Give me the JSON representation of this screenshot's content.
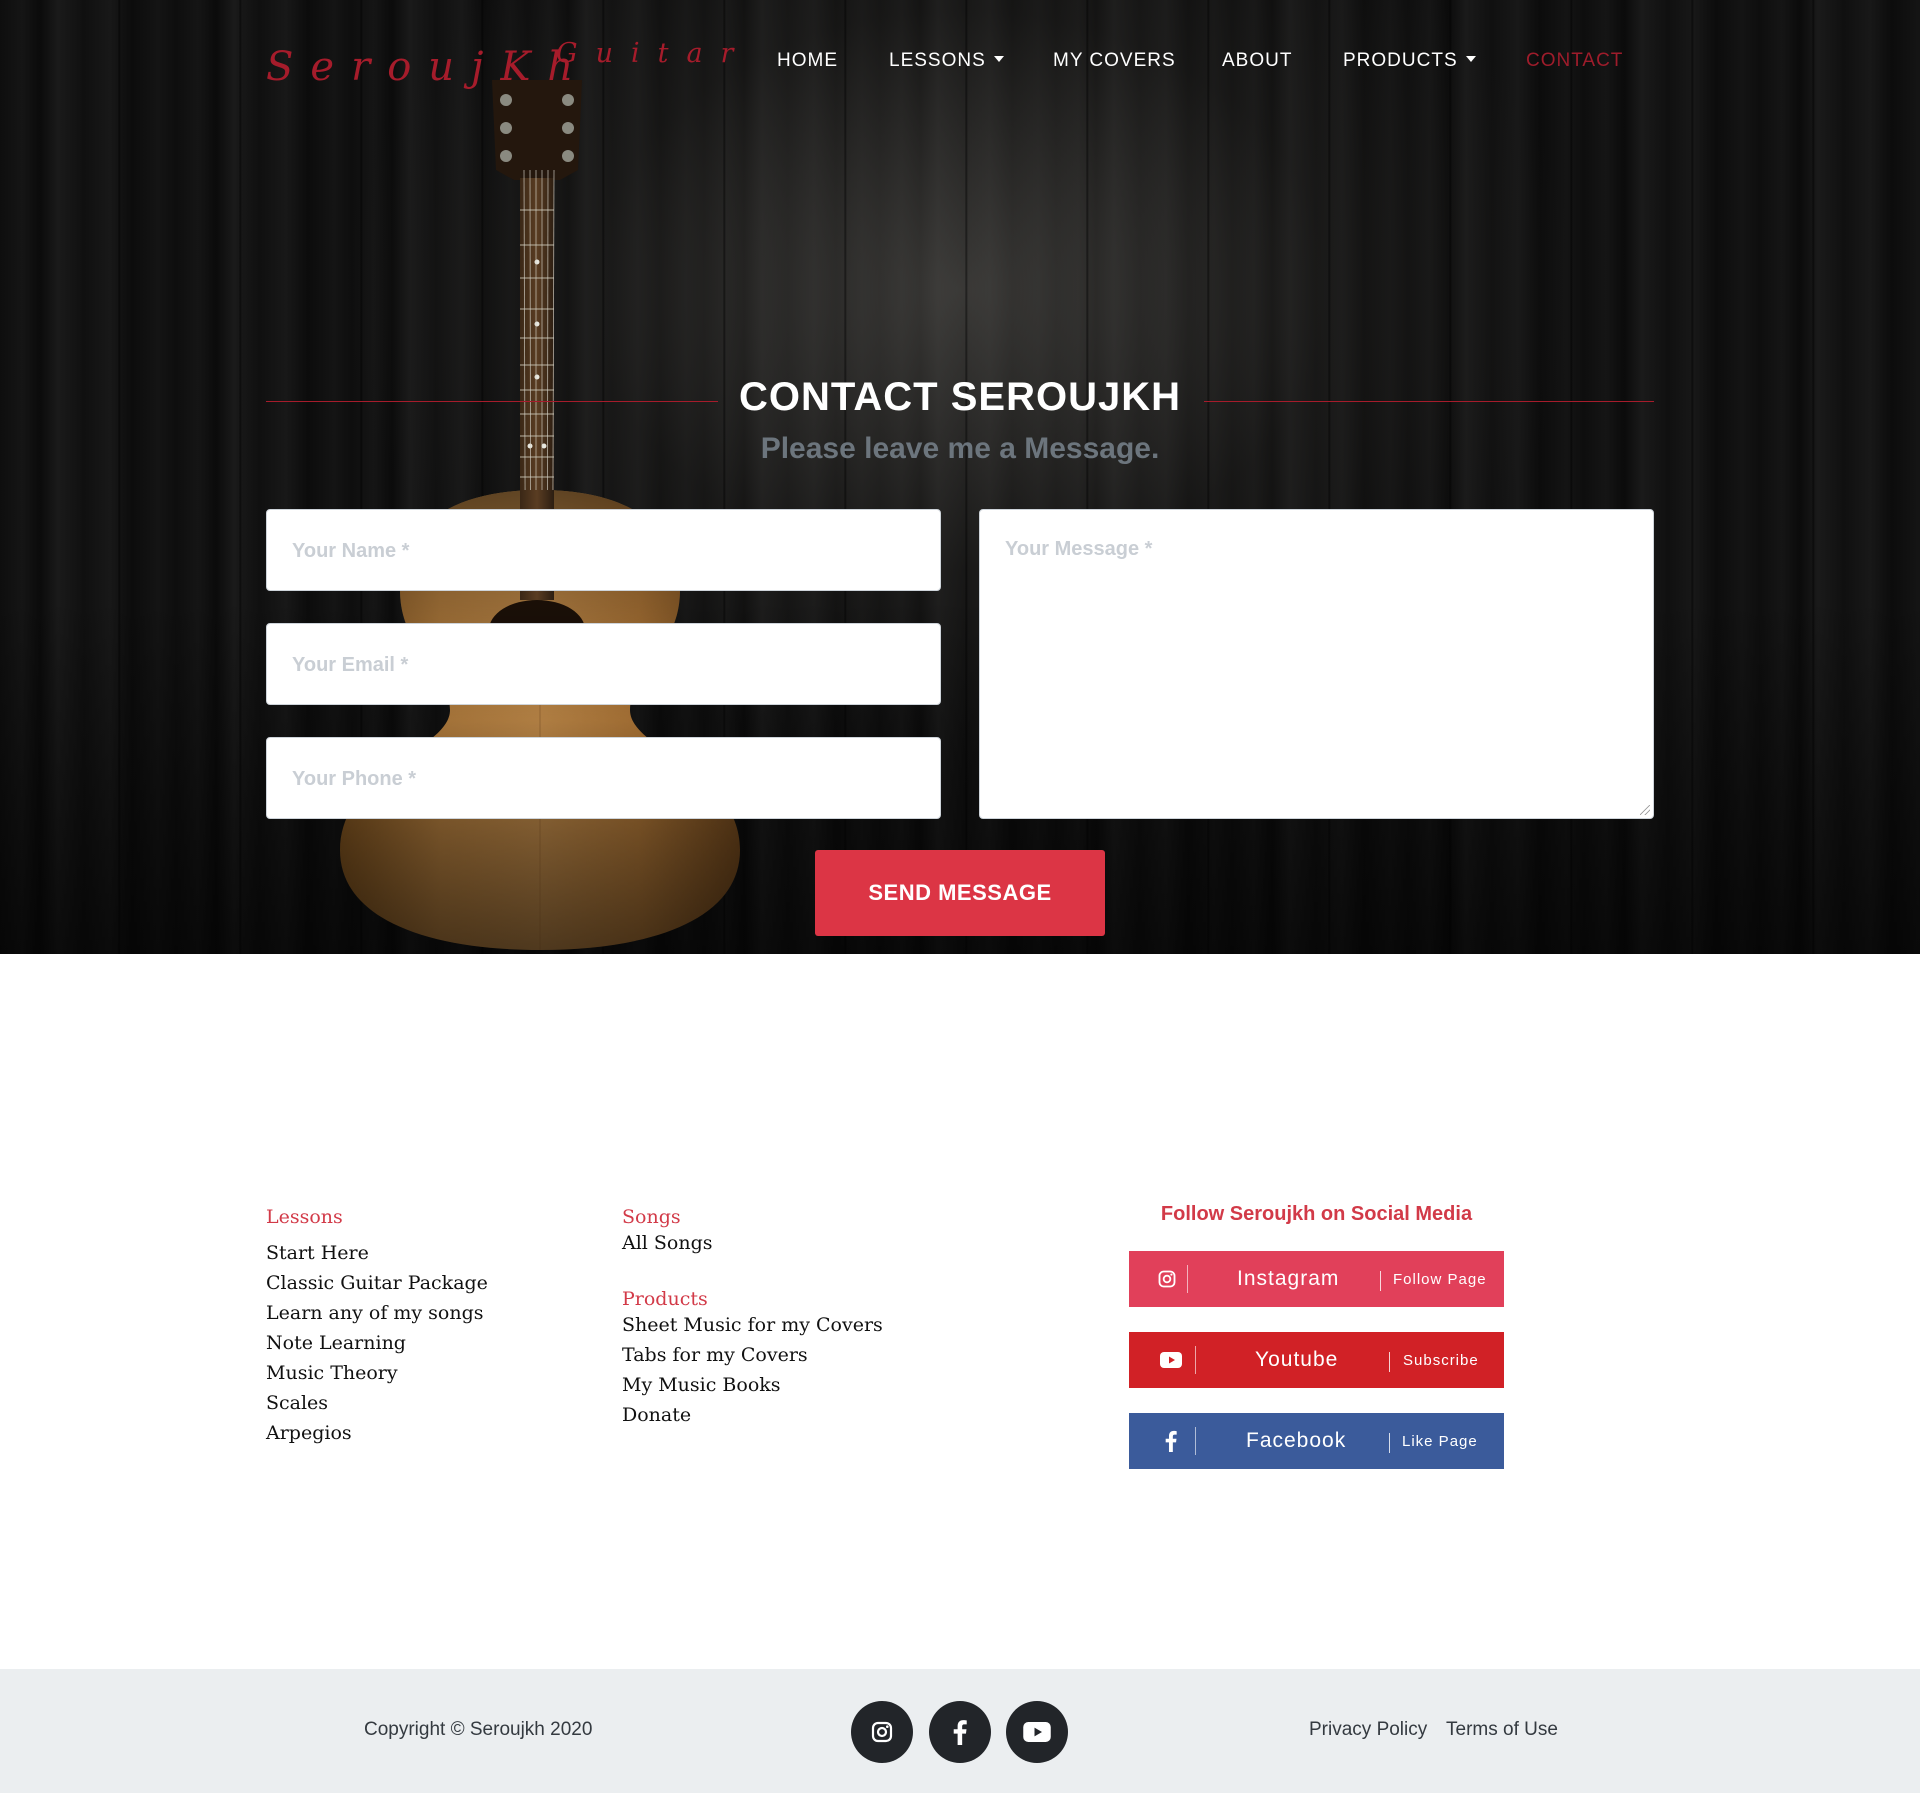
{
  "logo": {
    "word1": "SeroujKh",
    "word2": "Guitar"
  },
  "nav": {
    "home": "HOME",
    "lessons": "LESSONS",
    "covers": "MY COVERS",
    "about": "ABOUT",
    "products": "PRODUCTS",
    "contact": "CONTACT"
  },
  "contact": {
    "title": "CONTACT SEROUJKH",
    "subtitle": "Please leave me a Message.",
    "name_placeholder": "Your Name *",
    "email_placeholder": "Your Email *",
    "phone_placeholder": "Your Phone *",
    "message_placeholder": "Your Message *",
    "send_label": "SEND MESSAGE"
  },
  "footer": {
    "lessons_head": "Lessons",
    "lessons": [
      "Start Here",
      "Classic Guitar Package",
      "Learn any of my songs",
      "Note Learning",
      "Music Theory",
      "Scales",
      "Arpegios"
    ],
    "songs_head": "Songs",
    "songs": [
      "All Songs"
    ],
    "products_head": "Products",
    "products": [
      "Sheet Music for my Covers",
      "Tabs for my Covers",
      "My Music Books",
      "Donate"
    ],
    "social_title": "Follow Seroujkh on Social Media",
    "social": [
      {
        "name": "Instagram",
        "action": "Follow Page",
        "color": "#e1405a",
        "icon": "instagram-icon"
      },
      {
        "name": "Youtube",
        "action": "Subscribe",
        "color": "#d12126",
        "icon": "youtube-icon"
      },
      {
        "name": "Facebook",
        "action": "Like Page",
        "color": "#3b5b9b",
        "icon": "facebook-icon"
      }
    ]
  },
  "bottom": {
    "copyright": "Copyright © Seroujkh 2020",
    "privacy": "Privacy Policy",
    "terms": "Terms of Use"
  },
  "colors": {
    "accent": "#dc3545",
    "brand_red": "#a61c2b",
    "bottom_bar": "#ebeef0"
  }
}
